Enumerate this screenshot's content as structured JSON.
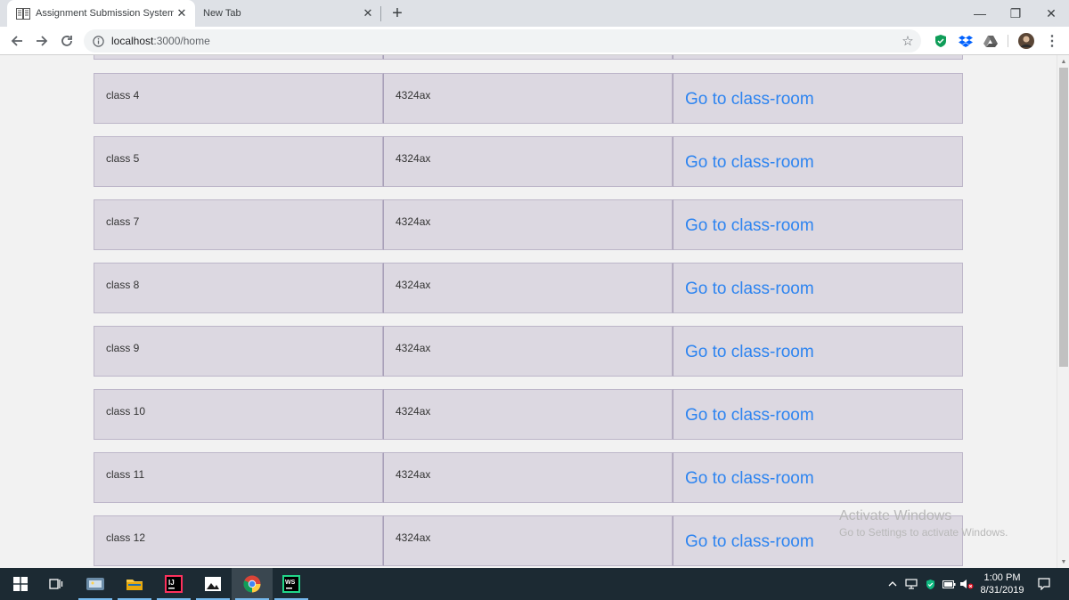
{
  "browser": {
    "tabs": [
      {
        "title": "Assignment Submission System",
        "active": true,
        "favicon": "book-icon"
      },
      {
        "title": "New Tab",
        "active": false
      }
    ],
    "new_tab_symbol": "+",
    "url": {
      "host": "localhost",
      "path": ":3000/home"
    },
    "window_controls": {
      "minimize": "—",
      "restore": "❐",
      "close": "✕"
    }
  },
  "page": {
    "rows": [
      {
        "name": "class 4",
        "code": "4324ax",
        "link": "Go to class-room"
      },
      {
        "name": "class 5",
        "code": "4324ax",
        "link": "Go to class-room"
      },
      {
        "name": "class 7",
        "code": "4324ax",
        "link": "Go to class-room"
      },
      {
        "name": "class 8",
        "code": "4324ax",
        "link": "Go to class-room"
      },
      {
        "name": "class 9",
        "code": "4324ax",
        "link": "Go to class-room"
      },
      {
        "name": "class 10",
        "code": "4324ax",
        "link": "Go to class-room"
      },
      {
        "name": "class 11",
        "code": "4324ax",
        "link": "Go to class-room"
      },
      {
        "name": "class 12",
        "code": "4324ax",
        "link": "Go to class-room"
      }
    ]
  },
  "watermark": {
    "title": "Activate Windows",
    "subtitle": "Go to Settings to activate Windows."
  },
  "taskbar": {
    "apps": [
      "windows-start",
      "task-view",
      "photos",
      "file-explorer",
      "intellij",
      "gallery",
      "chrome",
      "webstorm"
    ],
    "clock": {
      "time": "1:00 PM",
      "date": "8/31/2019"
    }
  },
  "colors": {
    "cell_bg": "#dcd8e1",
    "link": "#2d84f0",
    "taskbar": "#1c2a33"
  }
}
